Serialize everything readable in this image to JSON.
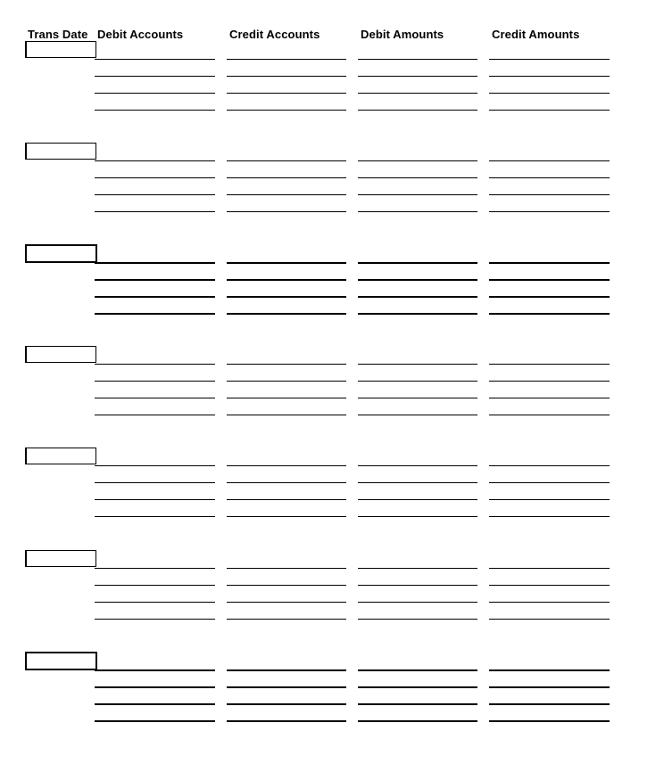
{
  "headers": {
    "trans_date": "Trans Date",
    "debit_accounts": "Debit Accounts",
    "credit_accounts": "Credit Accounts",
    "debit_amounts": "Debit Amounts",
    "credit_amounts": "Credit Amounts"
  },
  "entries": [
    {
      "trans_date": "",
      "rows": 4,
      "emphasis": false
    },
    {
      "trans_date": "",
      "rows": 4,
      "emphasis": false
    },
    {
      "trans_date": "",
      "rows": 4,
      "emphasis": true
    },
    {
      "trans_date": "",
      "rows": 4,
      "emphasis": false
    },
    {
      "trans_date": "",
      "rows": 4,
      "emphasis": false
    },
    {
      "trans_date": "",
      "rows": 4,
      "emphasis": false
    },
    {
      "trans_date": "",
      "rows": 4,
      "emphasis": true
    }
  ],
  "columns": [
    "debit-accounts",
    "credit-accounts",
    "debit-amounts",
    "credit-amounts"
  ]
}
